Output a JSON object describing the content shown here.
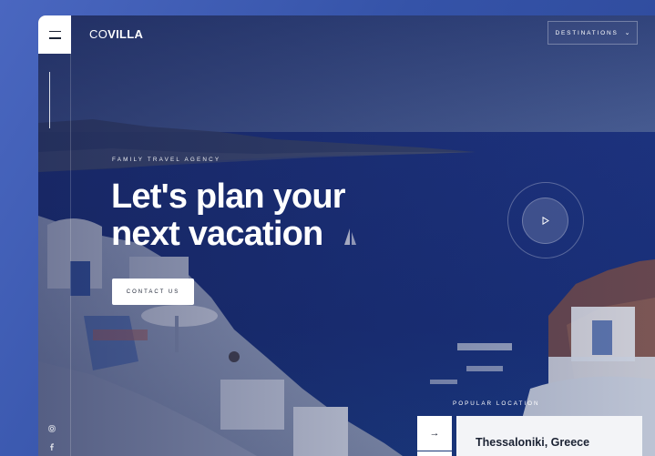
{
  "brand": {
    "logo_part1": "CO",
    "logo_part2": "VILLA"
  },
  "header": {
    "destinations_label": "DESTINATIONS"
  },
  "hero": {
    "eyebrow": "FAMILY TRAVEL AGENCY",
    "headline_line1": "Let's plan your",
    "headline_line2": "next vacation",
    "cta_label": "CONTACT US"
  },
  "popular": {
    "label": "POPULAR LOCATION",
    "location_name": "Thessaloniki, Greece"
  },
  "icons": {
    "menu": "hamburger-icon",
    "chevron": "chevron-down-icon",
    "play": "play-icon",
    "arrow": "arrow-right-icon",
    "instagram": "instagram-icon",
    "facebook": "facebook-icon"
  },
  "colors": {
    "accent_blue": "#3a5cb3",
    "sea": "#1e3a8a",
    "card_bg": "#f3f4f7",
    "text_dark": "#1b2233"
  }
}
